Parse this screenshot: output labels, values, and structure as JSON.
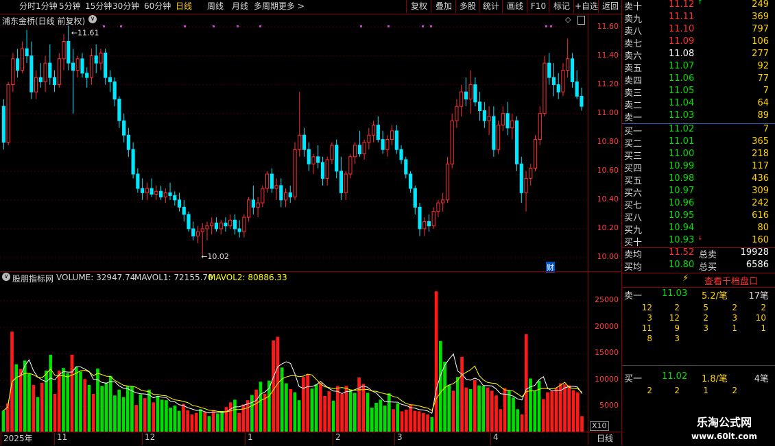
{
  "toolbar": {
    "left": [
      "分时",
      "1分钟",
      "5分钟",
      "15分钟",
      "30分钟",
      "60分钟",
      "日线",
      "周线",
      "月线",
      "多周期",
      "更多 >"
    ],
    "selected": "日线",
    "right": [
      "复权",
      "叠加",
      "多股",
      "统计",
      "画线",
      "F10",
      "标记",
      "+自选",
      "返回"
    ]
  },
  "main": {
    "title": "浦东金桥(日线 前复权)",
    "y_ticks": [
      "11.60",
      "11.40",
      "11.20",
      "11.00",
      "10.80",
      "10.60",
      "10.40",
      "10.20",
      "10.00"
    ],
    "high_label": "11.61",
    "low_label": "10.02",
    "cai_label": "财"
  },
  "volume": {
    "indicator_name": "股朋指标网",
    "volume_label": "VOLUME: 32947.74",
    "mavol1_label": "MAVOL1: 72155.70",
    "mavol2_label": "MAVOL2: 80886.33",
    "y_ticks": [
      "25000",
      "20000",
      "15000",
      "10000",
      "5000"
    ],
    "x10": "X10"
  },
  "x_axis": {
    "labels": [
      "2025年",
      "11",
      "12",
      "1",
      "2",
      "3",
      "4"
    ],
    "period": "日线"
  },
  "book": {
    "sell": [
      {
        "name": "卖十",
        "price": "11.12",
        "qty": "249",
        "mark": "↑"
      },
      {
        "name": "卖九",
        "price": "11.11",
        "qty": "369"
      },
      {
        "name": "卖八",
        "price": "11.10",
        "qty": "797"
      },
      {
        "name": "卖七",
        "price": "11.09",
        "qty": "106"
      },
      {
        "name": "卖六",
        "price": "11.08",
        "qty": "277"
      },
      {
        "name": "卖五",
        "price": "11.07",
        "qty": "92"
      },
      {
        "name": "卖四",
        "price": "11.06",
        "qty": "77"
      },
      {
        "name": "卖三",
        "price": "11.05",
        "qty": "7"
      },
      {
        "name": "卖二",
        "price": "11.04",
        "qty": "64"
      },
      {
        "name": "卖一",
        "price": "11.03",
        "qty": "89"
      }
    ],
    "buy": [
      {
        "name": "买一",
        "price": "11.02",
        "qty": "7"
      },
      {
        "name": "买二",
        "price": "11.01",
        "qty": "365"
      },
      {
        "name": "买三",
        "price": "11.00",
        "qty": "218"
      },
      {
        "name": "买四",
        "price": "10.99",
        "qty": "117"
      },
      {
        "name": "买五",
        "price": "10.98",
        "qty": "436"
      },
      {
        "name": "买六",
        "price": "10.97",
        "qty": "309"
      },
      {
        "name": "买七",
        "price": "10.96",
        "qty": "242"
      },
      {
        "name": "买八",
        "price": "10.95",
        "qty": "616"
      },
      {
        "name": "买九",
        "price": "10.94",
        "qty": "80"
      },
      {
        "name": "买十",
        "price": "10.93",
        "qty": "160",
        "mark": "↓"
      }
    ],
    "avg_sell": {
      "name": "卖均",
      "price": "11.52",
      "label": "总卖",
      "qty": "19928"
    },
    "avg_buy": {
      "name": "买均",
      "price": "10.80",
      "label": "总买",
      "qty": "6586"
    },
    "qiandang": "查看千档盘口",
    "s1": {
      "name": "卖一",
      "price": "11.03",
      "per": "5.2/笔",
      "count": "17笔",
      "rows": [
        [
          "12",
          "2",
          "5",
          "2",
          "2"
        ],
        [
          "3",
          "12",
          "2",
          "3",
          "10"
        ],
        [
          "11",
          "9",
          "3",
          "1",
          "1"
        ],
        [
          "8",
          "3",
          "",
          "",
          ""
        ]
      ]
    },
    "b1": {
      "name": "买一",
      "price": "11.02",
      "per": "1.8/笔",
      "count": "4笔",
      "rows": [
        [
          "2",
          "2",
          "1",
          "2",
          ""
        ]
      ]
    }
  },
  "watermark": {
    "line1": "乐淘公式网",
    "line2": "www.60lt.com"
  },
  "chart_data": {
    "type": "candlestick",
    "ylim": [
      10.0,
      11.65
    ],
    "up_color": "#ff3030",
    "down_color": "#00e8ff",
    "volume_up_color": "#ff1a1a",
    "volume_down_color": "#00e000",
    "mavol1_color": "#ffffff",
    "mavol2_color": "#ffff00",
    "ohlc": [
      [
        11.05,
        11.1,
        10.75,
        10.8
      ],
      [
        10.8,
        11.22,
        10.78,
        11.2
      ],
      [
        11.2,
        11.42,
        11.15,
        11.38
      ],
      [
        11.38,
        11.45,
        11.25,
        11.3
      ],
      [
        11.3,
        11.5,
        11.28,
        11.45
      ],
      [
        11.45,
        11.58,
        11.35,
        11.4
      ],
      [
        11.4,
        11.5,
        11.1,
        11.15
      ],
      [
        11.15,
        11.3,
        11.1,
        11.25
      ],
      [
        11.25,
        11.35,
        11.18,
        11.22
      ],
      [
        11.22,
        11.4,
        11.15,
        11.35
      ],
      [
        11.35,
        11.48,
        11.2,
        11.25
      ],
      [
        11.25,
        11.3,
        11.15,
        11.2
      ],
      [
        11.2,
        11.42,
        11.18,
        11.38
      ],
      [
        11.38,
        11.55,
        11.3,
        11.5
      ],
      [
        11.5,
        11.61,
        11.3,
        11.35
      ],
      [
        11.35,
        11.45,
        11.0,
        11.3
      ],
      [
        11.3,
        11.4,
        11.25,
        11.38
      ],
      [
        11.38,
        11.42,
        11.25,
        11.28
      ],
      [
        11.28,
        11.32,
        11.18,
        11.25
      ],
      [
        11.25,
        11.45,
        11.2,
        11.4
      ],
      [
        11.4,
        11.48,
        11.28,
        11.35
      ],
      [
        11.35,
        11.45,
        11.3,
        11.42
      ],
      [
        11.42,
        11.45,
        11.2,
        11.25
      ],
      [
        11.25,
        11.3,
        11.15,
        11.22
      ],
      [
        11.22,
        11.25,
        11.05,
        11.1
      ],
      [
        11.1,
        11.12,
        10.9,
        10.95
      ],
      [
        10.95,
        11.0,
        10.8,
        10.85
      ],
      [
        10.85,
        10.9,
        10.7,
        10.75
      ],
      [
        10.75,
        10.8,
        10.55,
        10.58
      ],
      [
        10.58,
        10.62,
        10.45,
        10.48
      ],
      [
        10.48,
        10.55,
        10.4,
        10.45
      ],
      [
        10.45,
        10.52,
        10.4,
        10.48
      ],
      [
        10.48,
        10.55,
        10.42,
        10.44
      ],
      [
        10.44,
        10.5,
        10.4,
        10.46
      ],
      [
        10.46,
        10.5,
        10.4,
        10.42
      ],
      [
        10.42,
        10.48,
        10.38,
        10.45
      ],
      [
        10.45,
        10.52,
        10.4,
        10.43
      ],
      [
        10.43,
        10.46,
        10.36,
        10.4
      ],
      [
        10.4,
        10.45,
        10.32,
        10.35
      ],
      [
        10.35,
        10.4,
        10.25,
        10.3
      ],
      [
        10.3,
        10.32,
        10.18,
        10.2
      ],
      [
        10.2,
        10.25,
        10.12,
        10.15
      ],
      [
        10.15,
        10.22,
        10.1,
        10.18
      ],
      [
        10.18,
        10.24,
        10.02,
        10.2
      ],
      [
        10.2,
        10.25,
        10.12,
        10.22
      ],
      [
        10.22,
        10.28,
        10.16,
        10.24
      ],
      [
        10.24,
        10.28,
        10.18,
        10.2
      ],
      [
        10.2,
        10.26,
        10.16,
        10.24
      ],
      [
        10.24,
        10.28,
        10.18,
        10.22
      ],
      [
        10.22,
        10.3,
        10.2,
        10.26
      ],
      [
        10.26,
        10.3,
        10.16,
        10.2
      ],
      [
        10.2,
        10.26,
        10.14,
        10.18
      ],
      [
        10.18,
        10.3,
        10.14,
        10.28
      ],
      [
        10.28,
        10.42,
        10.25,
        10.4
      ],
      [
        10.4,
        10.5,
        10.3,
        10.35
      ],
      [
        10.35,
        10.42,
        10.28,
        10.38
      ],
      [
        10.38,
        10.5,
        10.35,
        10.48
      ],
      [
        10.48,
        10.6,
        10.45,
        10.58
      ],
      [
        10.58,
        10.62,
        10.45,
        10.48
      ],
      [
        10.48,
        10.55,
        10.4,
        10.5
      ],
      [
        10.5,
        10.55,
        10.35,
        10.4
      ],
      [
        10.4,
        10.48,
        10.35,
        10.45
      ],
      [
        10.45,
        10.5,
        10.38,
        10.42
      ],
      [
        10.42,
        10.8,
        10.4,
        10.75
      ],
      [
        10.75,
        11.15,
        10.7,
        10.85
      ],
      [
        10.85,
        10.9,
        10.7,
        10.75
      ],
      [
        10.75,
        10.8,
        10.6,
        10.65
      ],
      [
        10.65,
        10.72,
        10.58,
        10.7
      ],
      [
        10.7,
        10.78,
        10.62,
        10.66
      ],
      [
        10.66,
        10.7,
        10.5,
        10.55
      ],
      [
        10.55,
        10.7,
        10.5,
        10.68
      ],
      [
        10.68,
        10.8,
        10.65,
        10.78
      ],
      [
        10.78,
        10.82,
        10.55,
        10.6
      ],
      [
        10.6,
        10.7,
        10.4,
        10.45
      ],
      [
        10.45,
        10.6,
        10.4,
        10.58
      ],
      [
        10.58,
        10.72,
        10.55,
        10.7
      ],
      [
        10.7,
        10.8,
        10.65,
        10.78
      ],
      [
        10.78,
        10.88,
        10.7,
        10.72
      ],
      [
        10.72,
        10.82,
        10.68,
        10.8
      ],
      [
        10.8,
        10.9,
        10.75,
        10.85
      ],
      [
        10.85,
        10.95,
        10.8,
        10.92
      ],
      [
        10.92,
        10.98,
        10.8,
        10.82
      ],
      [
        10.82,
        10.88,
        10.72,
        10.75
      ],
      [
        10.75,
        10.85,
        10.7,
        10.82
      ],
      [
        10.82,
        10.92,
        10.78,
        10.88
      ],
      [
        10.88,
        10.92,
        10.72,
        10.75
      ],
      [
        10.75,
        10.78,
        10.65,
        10.68
      ],
      [
        10.68,
        10.7,
        10.55,
        10.58
      ],
      [
        10.58,
        10.6,
        10.45,
        10.48
      ],
      [
        10.48,
        10.5,
        10.3,
        10.35
      ],
      [
        10.35,
        10.38,
        10.15,
        10.2
      ],
      [
        10.2,
        10.28,
        10.15,
        10.25
      ],
      [
        10.25,
        10.3,
        10.18,
        10.22
      ],
      [
        10.22,
        10.35,
        10.2,
        10.32
      ],
      [
        10.32,
        10.4,
        10.28,
        10.38
      ],
      [
        10.38,
        10.45,
        10.32,
        10.4
      ],
      [
        10.4,
        10.7,
        10.38,
        10.65
      ],
      [
        10.65,
        11.0,
        10.62,
        10.95
      ],
      [
        10.95,
        11.1,
        10.9,
        11.05
      ],
      [
        11.05,
        11.2,
        10.98,
        11.15
      ],
      [
        11.15,
        11.25,
        11.05,
        11.1
      ],
      [
        11.1,
        11.3,
        11.0,
        11.2
      ],
      [
        11.2,
        11.25,
        11.05,
        11.08
      ],
      [
        11.08,
        11.15,
        10.95,
        11.02
      ],
      [
        11.02,
        11.08,
        10.9,
        10.95
      ],
      [
        10.95,
        11.05,
        10.85,
        10.98
      ],
      [
        10.98,
        11.05,
        10.7,
        10.75
      ],
      [
        10.75,
        10.95,
        10.72,
        10.92
      ],
      [
        10.92,
        11.05,
        10.88,
        11.0
      ],
      [
        11.0,
        11.08,
        10.85,
        10.9
      ],
      [
        10.9,
        11.0,
        10.82,
        10.95
      ],
      [
        10.95,
        10.98,
        10.6,
        10.65
      ],
      [
        10.65,
        10.7,
        10.38,
        10.45
      ],
      [
        10.45,
        10.6,
        10.32,
        10.55
      ],
      [
        10.55,
        10.65,
        10.5,
        10.62
      ],
      [
        10.62,
        10.85,
        10.6,
        10.82
      ],
      [
        10.82,
        11.05,
        10.78,
        11.0
      ],
      [
        11.0,
        11.4,
        10.98,
        11.35
      ],
      [
        11.35,
        11.42,
        11.2,
        11.25
      ],
      [
        11.25,
        11.35,
        11.12,
        11.2
      ],
      [
        11.2,
        11.28,
        11.1,
        11.15
      ],
      [
        11.15,
        11.35,
        11.12,
        11.3
      ],
      [
        11.3,
        11.52,
        11.25,
        11.38
      ],
      [
        11.38,
        11.42,
        11.18,
        11.22
      ],
      [
        11.22,
        11.3,
        11.1,
        11.12
      ],
      [
        11.12,
        11.18,
        11.02,
        11.05
      ]
    ],
    "volume": [
      4200,
      5600,
      19200,
      13000,
      12100,
      13700,
      11200,
      9100,
      6800,
      9500,
      11800,
      14800,
      7400,
      11800,
      12300,
      11300,
      14800,
      12500,
      11600,
      10200,
      9100,
      7400,
      12200,
      8900,
      9500,
      10800,
      7100,
      8200,
      6800,
      8900,
      8800,
      5300,
      7300,
      6600,
      8200,
      5800,
      7000,
      6300,
      6200,
      4800,
      5200,
      4200,
      5500,
      4300,
      3500,
      3800,
      4500,
      4000,
      3200,
      4300,
      3700,
      4000,
      4900,
      5800,
      6300,
      3800,
      5400,
      6200,
      7200,
      8200,
      9700,
      7400,
      9900,
      17500,
      18200,
      12400,
      9400,
      8300,
      7700,
      6200,
      10600,
      11100,
      8400,
      9200,
      9500,
      7000,
      7900,
      6100,
      8900,
      7400,
      8900,
      8200,
      7600,
      10500,
      9300,
      7600,
      4800,
      5700,
      6300,
      5200,
      7500,
      4500,
      5600,
      4100,
      4400,
      5300,
      4200,
      4100,
      3800,
      3500,
      3000,
      26800,
      17400,
      13500,
      9100,
      8000,
      10600,
      14400,
      8600,
      8300,
      10000,
      9000,
      8900,
      8600,
      8000,
      7100,
      4500,
      8500,
      8000,
      6700,
      4500,
      3500,
      18700,
      10300,
      8000,
      9900,
      6400,
      7700,
      7900,
      8500,
      9400,
      9200,
      9000,
      8100,
      7700,
      3200
    ]
  }
}
